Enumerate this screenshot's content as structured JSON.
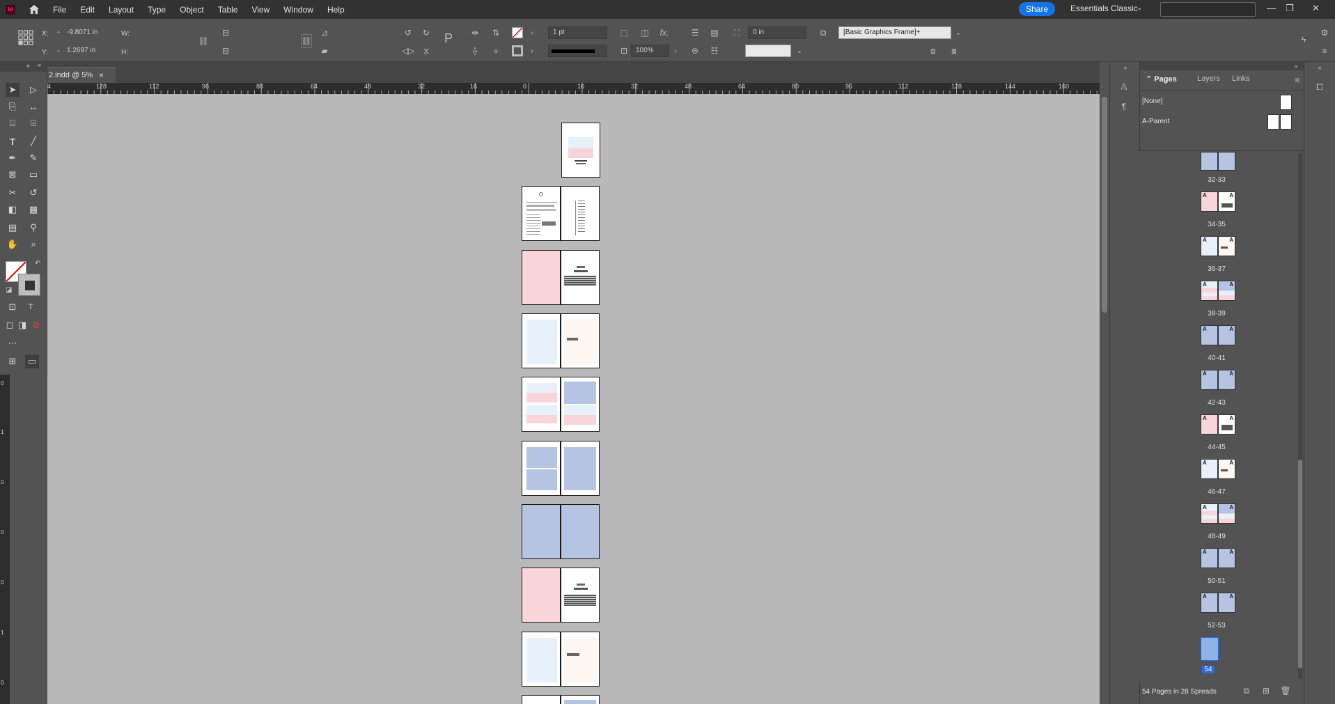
{
  "app": {
    "icon_label": "Id"
  },
  "menu": [
    "File",
    "Edit",
    "Layout",
    "Type",
    "Object",
    "Table",
    "View",
    "Window",
    "Help"
  ],
  "share_label": "Share",
  "workspace_label": "Essentials Classic",
  "control": {
    "x_label": "X:",
    "x_value": "-9.8071 in",
    "y_label": "Y:",
    "y_value": "1.2697 in",
    "w_label": "W:",
    "h_label": "H:",
    "stroke_weight": "1 pt",
    "scale": "100%",
    "offset": "0 in",
    "object_style": "[Basic Graphics Frame]+",
    "fx_label": "fx."
  },
  "document_tab": {
    "title": "2.indd @ 5%",
    "close": "×"
  },
  "ruler_ticks": [
    "4",
    "128",
    "112",
    "96",
    "80",
    "64",
    "48",
    "32",
    "16",
    "0",
    "16",
    "32",
    "48",
    "64",
    "80",
    "96",
    "112",
    "128",
    "144",
    "160"
  ],
  "vruler_ticks": [
    "0",
    "1",
    "0",
    "0",
    "0",
    "1",
    "0"
  ],
  "pages_panel": {
    "tabs": [
      "Pages",
      "Layers",
      "Links"
    ],
    "parents": [
      "[None]",
      "A-Parent"
    ],
    "spreads": [
      "32-33",
      "34-35",
      "36-37",
      "38-39",
      "40-41",
      "42-43",
      "44-45",
      "46-47",
      "48-49",
      "50-51",
      "52-53",
      "54"
    ],
    "page_marker": "A",
    "status": "54 Pages in 28 Spreads"
  },
  "colors": {
    "pink": "#f9d5d9",
    "light_blue": "#e6f1fb",
    "periwinkle": "#b4c4e2",
    "cream": "#fdf6f1",
    "selected_blue": "#2d6be0",
    "share_blue": "#1473e6"
  }
}
